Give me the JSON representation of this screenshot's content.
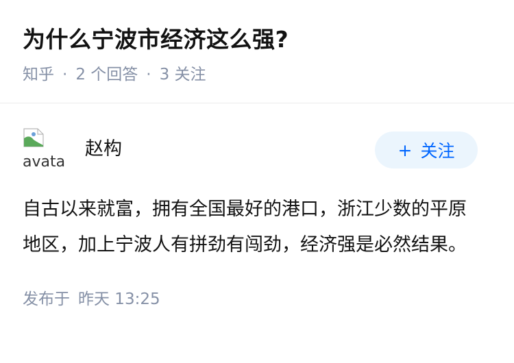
{
  "question": {
    "title": "为什么宁波市经济这么强?",
    "meta": {
      "source": "知乎",
      "answers": "2 个回答",
      "followers": "3 关注",
      "separator": "·"
    }
  },
  "answer": {
    "author": {
      "avatar_alt": "avatar",
      "name": "赵构"
    },
    "follow_button": {
      "icon": "plus-icon",
      "icon_glyph": "+",
      "label": "关注"
    },
    "content": "自古以来就富，拥有全国最好的港口，浙江少数的平原地区，加上宁波人有拼劲有闯劲，经济强是必然结果。",
    "published": {
      "prefix": "发布于",
      "time": "昨天 13:25"
    }
  },
  "colors": {
    "text_primary": "#121212",
    "text_secondary": "#8590a6",
    "accent": "#0066ff",
    "button_bg": "#ebf5fd"
  }
}
